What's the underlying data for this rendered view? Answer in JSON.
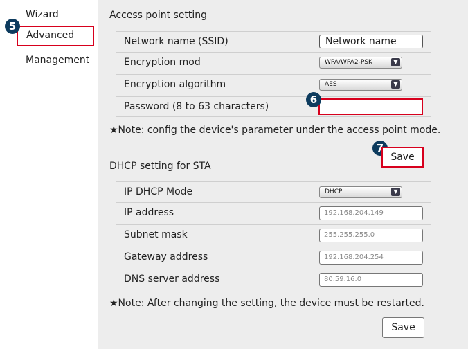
{
  "sidebar": {
    "items": [
      {
        "label": "Wizard"
      },
      {
        "label": "Advanced"
      },
      {
        "label": "Management"
      }
    ]
  },
  "badges": {
    "b5": "5",
    "b6": "6",
    "b7": "7"
  },
  "ap": {
    "title": "Access point setting",
    "rows": {
      "ssid": {
        "label": "Network name (SSID)",
        "value": "Network name"
      },
      "enc_mode": {
        "label": "Encryption mod",
        "value": "WPA/WPA2-PSK"
      },
      "enc_alg": {
        "label": "Encryption algorithm",
        "value": "AES"
      },
      "password": {
        "label": "Password (8 to 63 characters)",
        "value": ""
      }
    },
    "note": "★Note: config the device's parameter under the access point mode.",
    "save_label": "Save"
  },
  "dhcp": {
    "title": "DHCP setting for STA",
    "rows": {
      "mode": {
        "label": "IP DHCP Mode",
        "value": "DHCP"
      },
      "ip": {
        "label": "IP address",
        "placeholder": "192.168.204.149"
      },
      "mask": {
        "label": "Subnet mask",
        "placeholder": "255.255.255.0"
      },
      "gateway": {
        "label": "Gateway address",
        "placeholder": "192.168.204.254"
      },
      "dns": {
        "label": "DNS server address",
        "placeholder": "80.59.16.0"
      }
    },
    "note": "★Note: After changing the setting, the device must be restarted.",
    "save_label": "Save"
  },
  "colors": {
    "highlight": "#d7001d",
    "badge": "#0d3b5e",
    "panel": "#ededed"
  }
}
